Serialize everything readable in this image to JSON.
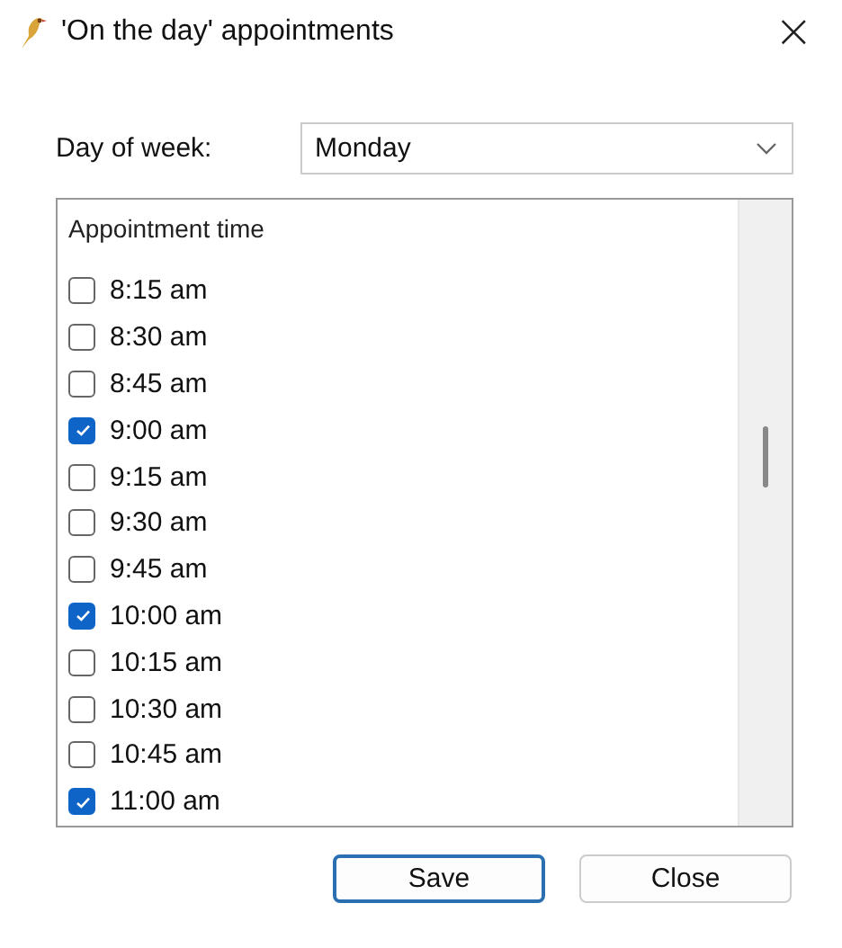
{
  "window": {
    "title": "'On the day' appointments",
    "close": "×"
  },
  "day_of_week": {
    "label": "Day of week:",
    "value": "Monday"
  },
  "appointments": {
    "header": "Appointment time",
    "items": [
      {
        "label": "8:15 am",
        "checked": false
      },
      {
        "label": "8:30 am",
        "checked": false
      },
      {
        "label": "8:45 am",
        "checked": false
      },
      {
        "label": "9:00 am",
        "checked": true
      },
      {
        "label": "9:15 am",
        "checked": false
      },
      {
        "label": "9:30 am",
        "checked": false
      },
      {
        "label": "9:45 am",
        "checked": false
      },
      {
        "label": "10:00 am",
        "checked": true
      },
      {
        "label": "10:15 am",
        "checked": false
      },
      {
        "label": "10:30 am",
        "checked": false
      },
      {
        "label": "10:45 am",
        "checked": false
      },
      {
        "label": "11:00 am",
        "checked": true
      }
    ]
  },
  "buttons": [
    {
      "label": "Save",
      "default": true
    },
    {
      "label": "Close",
      "default": false
    }
  ]
}
